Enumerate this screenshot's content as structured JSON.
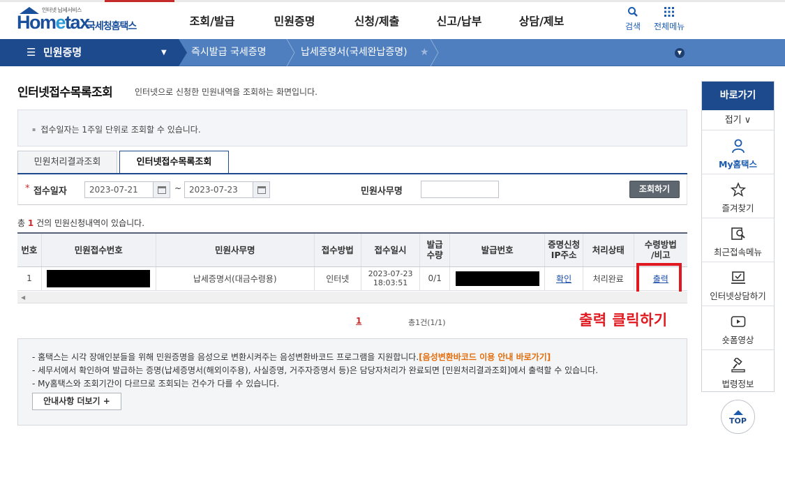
{
  "header": {
    "logo_small": "인터넷 납세서비스",
    "logo_main_a": "Hom",
    "logo_main_b": "e",
    "logo_main_c": "tax",
    "logo_sub": "국세청홈택스",
    "gnb": [
      "조회/발급",
      "민원증명",
      "신청/제출",
      "신고/납부",
      "상담/제보"
    ],
    "search_label": "검색",
    "allmenu_label": "전체메뉴"
  },
  "navbar": {
    "menu_label": "민원증명",
    "crumbs": [
      "즉시발급 국세증명",
      "납세증명서(국세완납증명)"
    ]
  },
  "page": {
    "title": "인터넷접수목록조회",
    "description": "인터넷으로 신청한 민원내역을 조회하는 화면입니다.",
    "info": "접수일자는 1주일 단위로 조회할 수 있습니다."
  },
  "tabs": [
    "민원처리결과조회",
    "인터넷접수목록조회"
  ],
  "search": {
    "date_label": "접수일자",
    "date_from": "2023-07-21",
    "date_to": "2023-07-23",
    "tilde": "~",
    "office_label": "민원사무명",
    "office_value": "",
    "search_button": "조회하기"
  },
  "result": {
    "count_prefix": "총",
    "count": "1",
    "count_suffix": "건의 민원신청내역이 있습니다."
  },
  "table": {
    "headers": [
      "번호",
      "민원접수번호",
      "민원사무명",
      "접수방법",
      "접수일시",
      "발급\n수량",
      "발급번호",
      "증명신청\nIP주소",
      "처리상태",
      "수령방법\n/비고"
    ],
    "rows": [
      {
        "no": "1",
        "office": "납세증명서(대금수령용)",
        "method": "인터넷",
        "date": "2023-07-23",
        "time": "18:03:51",
        "qty": "0/1",
        "ip_link": "확인",
        "status": "처리완료",
        "receive_link": "출력"
      }
    ]
  },
  "pagination": {
    "current": "1",
    "total": "총1건(1/1)"
  },
  "callout": "출력 클릭하기",
  "notice": {
    "line1_text": "- 홈택스는 시각 장애인분들을 위해 민원증명을 음성으로 변환시켜주는 음성변환바코드 프로그램을 지원합니다.",
    "line1_link": "[음성변환바코드 이용 안내 바로가기]",
    "line2": "- 세무서에서 확인하여 발급하는 증명(납세증명서(해외이주용), 사실증명, 거주자증명서 등)은 담당자처리가 완료되면 [민원처리결과조회]에서 출력할 수 있습니다.",
    "line3": "- My홈택스와 조회기간이 다르므로 조회되는 건수가 다를 수 있습니다.",
    "more_button": "안내사항 더보기 +"
  },
  "quick": {
    "head": "바로가기",
    "fold": "접기 ∨",
    "items": [
      "My홈택스",
      "즐겨찾기",
      "최근접속메뉴",
      "인터넷상담하기",
      "숏폼영상",
      "법령정보"
    ],
    "top": "TOP"
  },
  "colors": {
    "brand_navy": "#1d4a8c",
    "nav_blue": "#4f7fbf",
    "highlight_red": "#e0181f"
  }
}
